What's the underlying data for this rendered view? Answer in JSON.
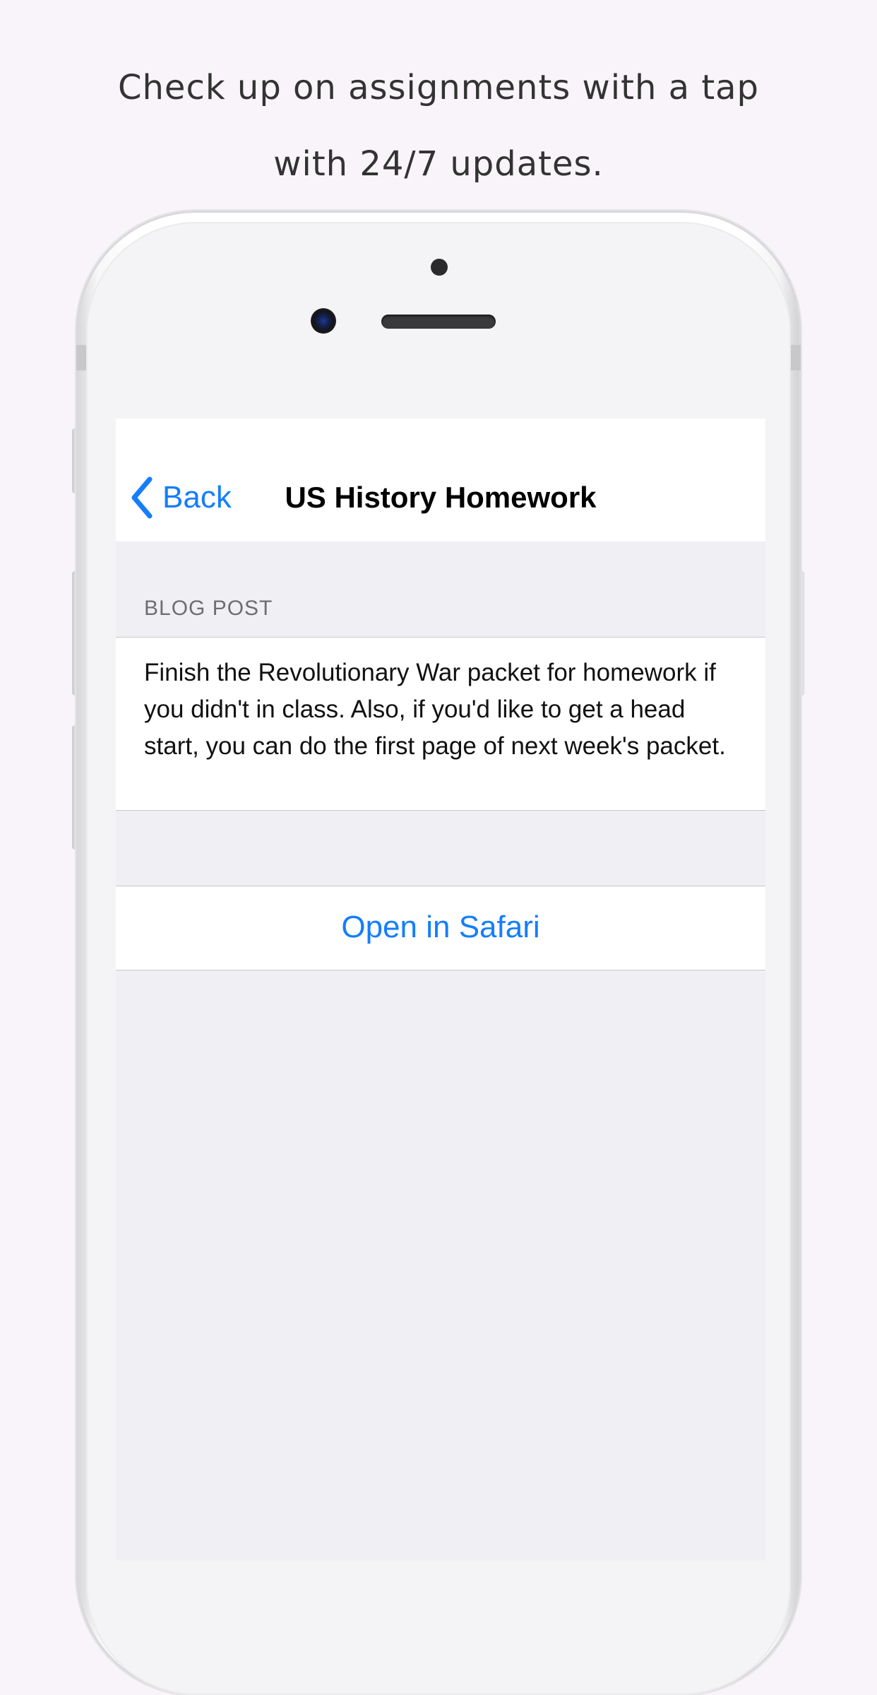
{
  "promo": {
    "line1": "Check up on assignments with a tap",
    "line2": "with 24/7 updates."
  },
  "navbar": {
    "back_label": "Back",
    "title": "US History Homework",
    "back_icon": "chevron-left-icon"
  },
  "content": {
    "section_header": "BLOG POST",
    "post_text": "Finish the Revolutionary War packet for homework if you didn't in class. Also, if you'd like to get a head start, you can do the first page of next week's packet.",
    "action_label": "Open in Safari"
  },
  "colors": {
    "page_background": "#f8f4f9",
    "ios_tint": "#147efb",
    "grouped_background": "#efeff4",
    "section_header_text": "#6d6d72"
  }
}
